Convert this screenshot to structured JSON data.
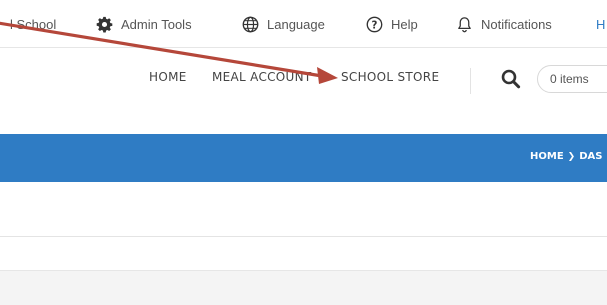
{
  "utility_bar": {
    "school_label": "l School",
    "admin_tools_label": "Admin Tools",
    "language_label": "Language",
    "help_label": "Help",
    "notifications_label": "Notifications",
    "clipped_label": "H"
  },
  "main_nav": {
    "home_label": "HOME",
    "meal_account_label": "MEAL ACCOUNT",
    "school_store_label": "SCHOOL STORE",
    "cart_label": "0 items"
  },
  "banner": {
    "breadcrumb_home": "HOME",
    "breadcrumb_separator": "❯",
    "breadcrumb_current": "DAS"
  },
  "colors": {
    "banner": "#2f7cc4",
    "annotation_arrow": "#b5473a"
  },
  "icons": {
    "admin_tools": "gear-icon",
    "language": "globe-icon",
    "help": "question-circle-icon",
    "notifications": "bell-icon",
    "search": "search-icon"
  }
}
